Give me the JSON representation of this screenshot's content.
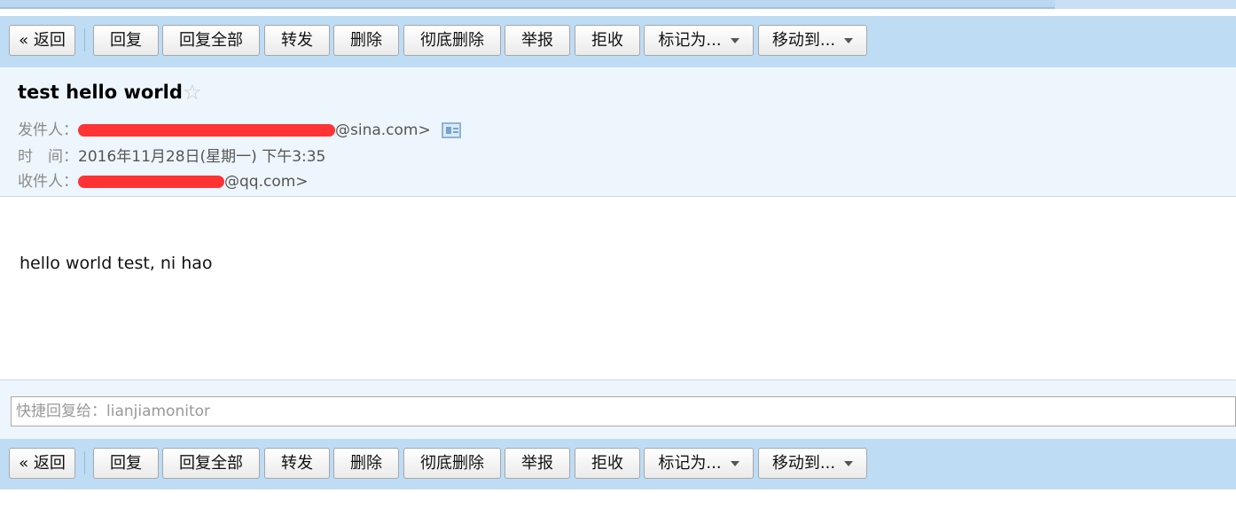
{
  "toolbar": {
    "back": "« 返回",
    "reply": "回复",
    "reply_all": "回复全部",
    "forward": "转发",
    "delete": "删除",
    "delete_permanently": "彻底删除",
    "report": "举报",
    "reject": "拒收",
    "mark_as": "标记为...",
    "move_to": "移动到..."
  },
  "message": {
    "subject": "test hello world",
    "star": "☆",
    "from_label": "发件人：",
    "from_value": "@sina.com>",
    "time_label": "时　间：",
    "time_value": "2016年11月28日(星期一) 下午3:35",
    "to_label": "收件人：",
    "to_value": "@qq.com>",
    "body": "hello world test, ni hao"
  },
  "quick_reply": {
    "placeholder": "快捷回复给：lianjiamonitor"
  },
  "colors": {
    "toolbar_bg": "#bfdcf5",
    "header_bg": "#eef6fd",
    "redaction": "#ff3333"
  }
}
